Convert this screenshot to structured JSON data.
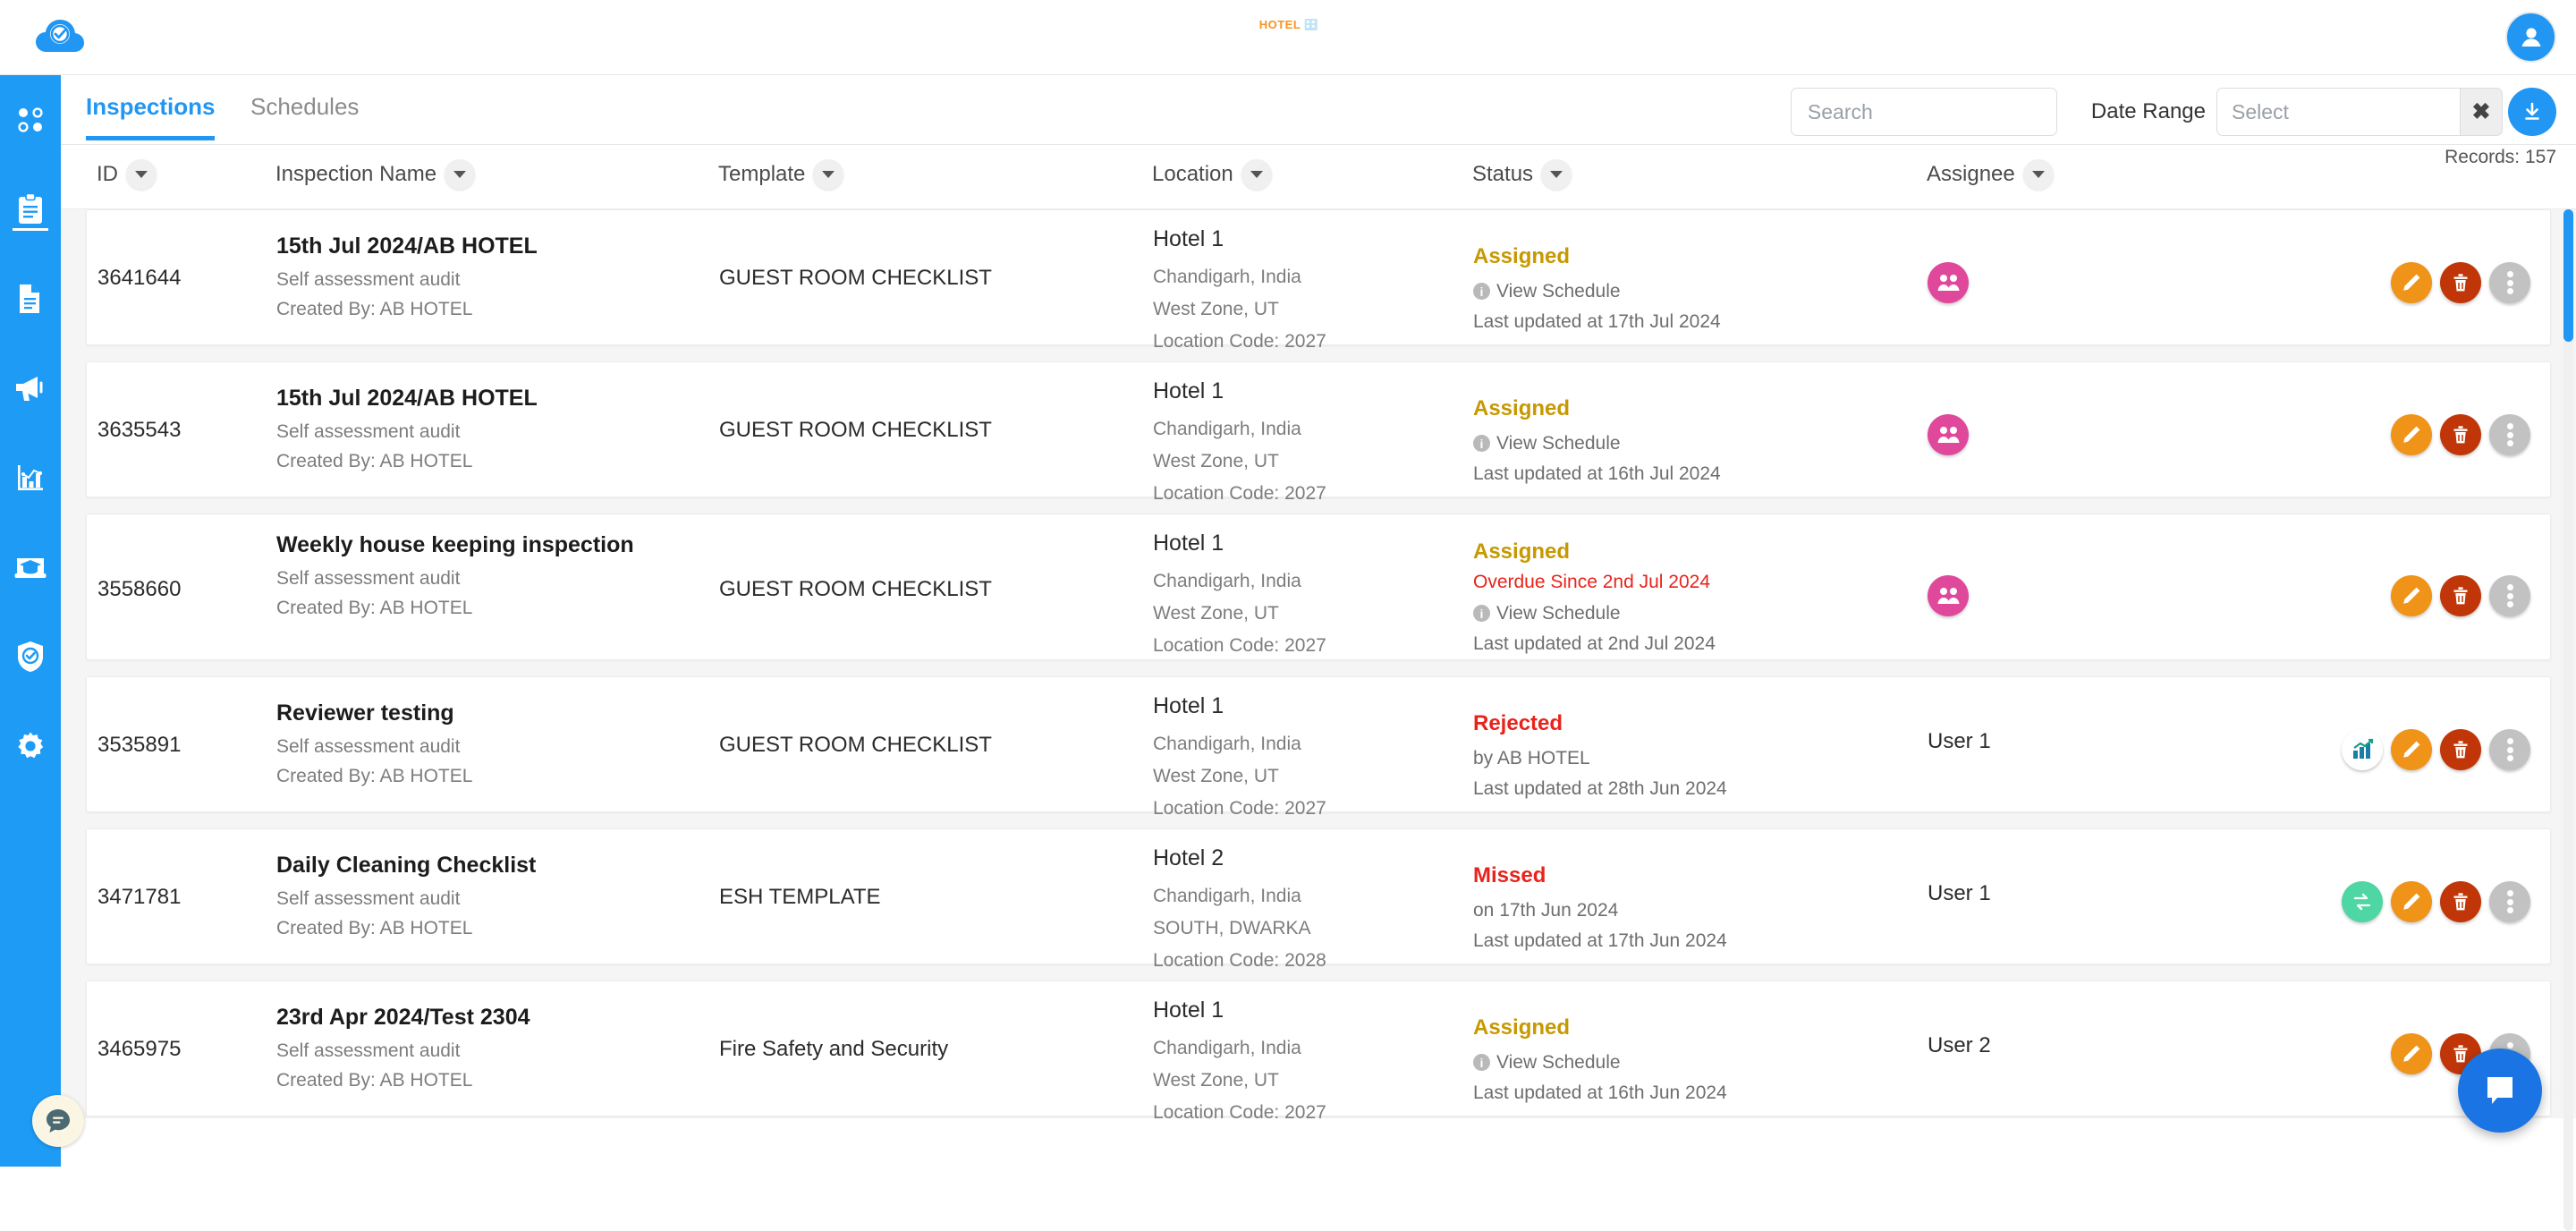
{
  "app": {
    "brand_icon": "cloud-check-icon",
    "center_logo_text": "HOTEL",
    "center_logo_mark": "building-icon",
    "avatar_icon": "user-avatar-icon"
  },
  "sidebar": {
    "items": [
      {
        "name": "dashboard",
        "icon": "four-dots-icon",
        "active": false
      },
      {
        "name": "inspections",
        "icon": "clipboard-icon",
        "active": true
      },
      {
        "name": "documents",
        "icon": "document-icon",
        "active": false
      },
      {
        "name": "announcements",
        "icon": "megaphone-icon",
        "active": false
      },
      {
        "name": "analytics",
        "icon": "bar-chart-icon",
        "active": false
      },
      {
        "name": "training",
        "icon": "graduation-cap-icon",
        "active": false
      },
      {
        "name": "compliance",
        "icon": "shield-check-icon",
        "active": false
      },
      {
        "name": "settings",
        "icon": "gear-icon",
        "active": false
      }
    ],
    "chat_icon": "chat-bubble-icon"
  },
  "tabs": [
    {
      "id": "inspections",
      "label": "Inspections",
      "active": true
    },
    {
      "id": "schedules",
      "label": "Schedules",
      "active": false
    }
  ],
  "toolbar": {
    "search_placeholder": "Search",
    "search_value": "",
    "date_range_label": "Date Range",
    "date_range_placeholder": "Select",
    "date_range_value": "",
    "clear_icon": "close-x-icon",
    "download_icon": "download-icon",
    "records_text": "Records: 157"
  },
  "table": {
    "columns": [
      {
        "key": "id",
        "label": "ID"
      },
      {
        "key": "name",
        "label": "Inspection Name"
      },
      {
        "key": "template",
        "label": "Template"
      },
      {
        "key": "location",
        "label": "Location"
      },
      {
        "key": "status",
        "label": "Status"
      },
      {
        "key": "assignee",
        "label": "Assignee"
      }
    ],
    "rows": [
      {
        "id": "3641644",
        "name_title": "15th Jul 2024/AB HOTEL",
        "name_type": "Self assessment audit",
        "name_creator": "Created By: AB HOTEL",
        "template": "GUEST ROOM CHECKLIST",
        "loc_title": "Hotel 1",
        "loc_city": "Chandigarh, India",
        "loc_zone": "West Zone, UT",
        "loc_code": "Location Code: 2027",
        "status_label": "Assigned",
        "status_kind": "assigned",
        "status_overdue": "",
        "status_schedule": "View Schedule",
        "status_updated": "Last updated at 17th Jul 2024",
        "assignee_text": "",
        "assignee_group": true,
        "actions": [
          "edit",
          "delete",
          "more"
        ]
      },
      {
        "id": "3635543",
        "name_title": "15th Jul 2024/AB HOTEL",
        "name_type": "Self assessment audit",
        "name_creator": "Created By: AB HOTEL",
        "template": "GUEST ROOM CHECKLIST",
        "loc_title": "Hotel 1",
        "loc_city": "Chandigarh, India",
        "loc_zone": "West Zone, UT",
        "loc_code": "Location Code: 2027",
        "status_label": "Assigned",
        "status_kind": "assigned",
        "status_overdue": "",
        "status_schedule": "View Schedule",
        "status_updated": "Last updated at 16th Jul 2024",
        "assignee_text": "",
        "assignee_group": true,
        "actions": [
          "edit",
          "delete",
          "more"
        ]
      },
      {
        "id": "3558660",
        "name_title": "Weekly house keeping inspection",
        "name_type": "Self assessment audit",
        "name_creator": "Created By: AB HOTEL",
        "template": "GUEST ROOM CHECKLIST",
        "loc_title": "Hotel 1",
        "loc_city": "Chandigarh, India",
        "loc_zone": "West Zone, UT",
        "loc_code": "Location Code: 2027",
        "status_label": "Assigned",
        "status_kind": "assigned",
        "status_overdue": "Overdue Since 2nd Jul 2024",
        "status_schedule": "View Schedule",
        "status_updated": "Last updated at 2nd Jul 2024",
        "assignee_text": "",
        "assignee_group": true,
        "actions": [
          "edit",
          "delete",
          "more"
        ]
      },
      {
        "id": "3535891",
        "name_title": "Reviewer testing",
        "name_type": "Self assessment audit",
        "name_creator": "Created By: AB HOTEL",
        "template": "GUEST ROOM CHECKLIST",
        "loc_title": "Hotel 1",
        "loc_city": "Chandigarh, India",
        "loc_zone": "West Zone, UT",
        "loc_code": "Location Code: 2027",
        "status_label": "Rejected",
        "status_kind": "rejected",
        "status_overdue": "",
        "status_schedule": "",
        "status_by": "by AB HOTEL",
        "status_updated": "Last updated at 28th Jun 2024",
        "assignee_text": "User 1",
        "assignee_group": false,
        "actions": [
          "report",
          "edit",
          "delete",
          "more"
        ]
      },
      {
        "id": "3471781",
        "name_title": "Daily Cleaning Checklist",
        "name_type": "Self assessment audit",
        "name_creator": "Created By: AB HOTEL",
        "template": "ESH TEMPLATE",
        "loc_title": "Hotel 2",
        "loc_city": "Chandigarh, India",
        "loc_zone": "SOUTH, DWARKA",
        "loc_code": "Location Code: 2028",
        "status_label": "Missed",
        "status_kind": "missed",
        "status_overdue": "",
        "status_schedule": "",
        "status_by": "on 17th Jun 2024",
        "status_updated": "Last updated at 17th Jun 2024",
        "assignee_text": "User 1",
        "assignee_group": false,
        "actions": [
          "swap",
          "edit",
          "delete",
          "more"
        ]
      },
      {
        "id": "3465975",
        "name_title": "23rd Apr 2024/Test 2304",
        "name_type": "Self assessment audit",
        "name_creator": "Created By: AB HOTEL",
        "template": "Fire Safety and Security",
        "loc_title": "Hotel 1",
        "loc_city": "Chandigarh, India",
        "loc_zone": "West Zone, UT",
        "loc_code": "Location Code: 2027",
        "status_label": "Assigned",
        "status_kind": "assigned",
        "status_overdue": "",
        "status_schedule": "View Schedule",
        "status_updated": "Last updated at 16th Jun 2024",
        "assignee_text": "User 2",
        "assignee_group": false,
        "actions": [
          "edit",
          "delete",
          "more"
        ]
      }
    ]
  },
  "chat_widget": {
    "icon": "chat-bubble-icon"
  },
  "colors": {
    "accent": "#2196f3",
    "sidebar": "#1e9bf5",
    "assigned": "#c79800",
    "rejected": "#e8231b",
    "missed": "#e8231b",
    "overdue": "#e8231b",
    "edit": "#ef9419",
    "delete": "#c03608",
    "more": "#c2c2c2",
    "swap": "#4ed6a4",
    "group": "#e0499b"
  }
}
